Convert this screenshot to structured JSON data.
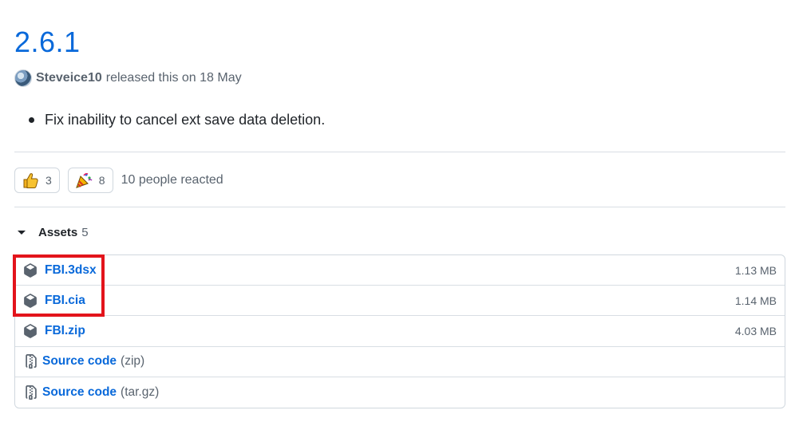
{
  "release": {
    "version": "2.6.1",
    "author": "Steveice10",
    "meta_text": "released this on 18 May"
  },
  "notes": {
    "items": [
      "Fix inability to cancel ext save data deletion."
    ]
  },
  "reactions": {
    "items": [
      {
        "icon": "thumbs-up-icon",
        "count": "3"
      },
      {
        "icon": "party-popper-icon",
        "count": "8"
      }
    ],
    "summary": "10 people reacted"
  },
  "assets": {
    "title": "Assets",
    "count": "5",
    "items": [
      {
        "icon": "package-icon",
        "name": "FBI.3dsx",
        "suffix": "",
        "size": "1.13 MB"
      },
      {
        "icon": "package-icon",
        "name": "FBI.cia",
        "suffix": "",
        "size": "1.14 MB"
      },
      {
        "icon": "package-icon",
        "name": "FBI.zip",
        "suffix": "",
        "size": "4.03 MB"
      },
      {
        "icon": "file-zip-icon",
        "name": "Source code",
        "suffix": "(zip)",
        "size": ""
      },
      {
        "icon": "file-zip-icon",
        "name": "Source code",
        "suffix": "(tar.gz)",
        "size": ""
      }
    ]
  },
  "colors": {
    "link": "#0969da",
    "muted": "#59636e",
    "highlight": "#e3141b"
  }
}
